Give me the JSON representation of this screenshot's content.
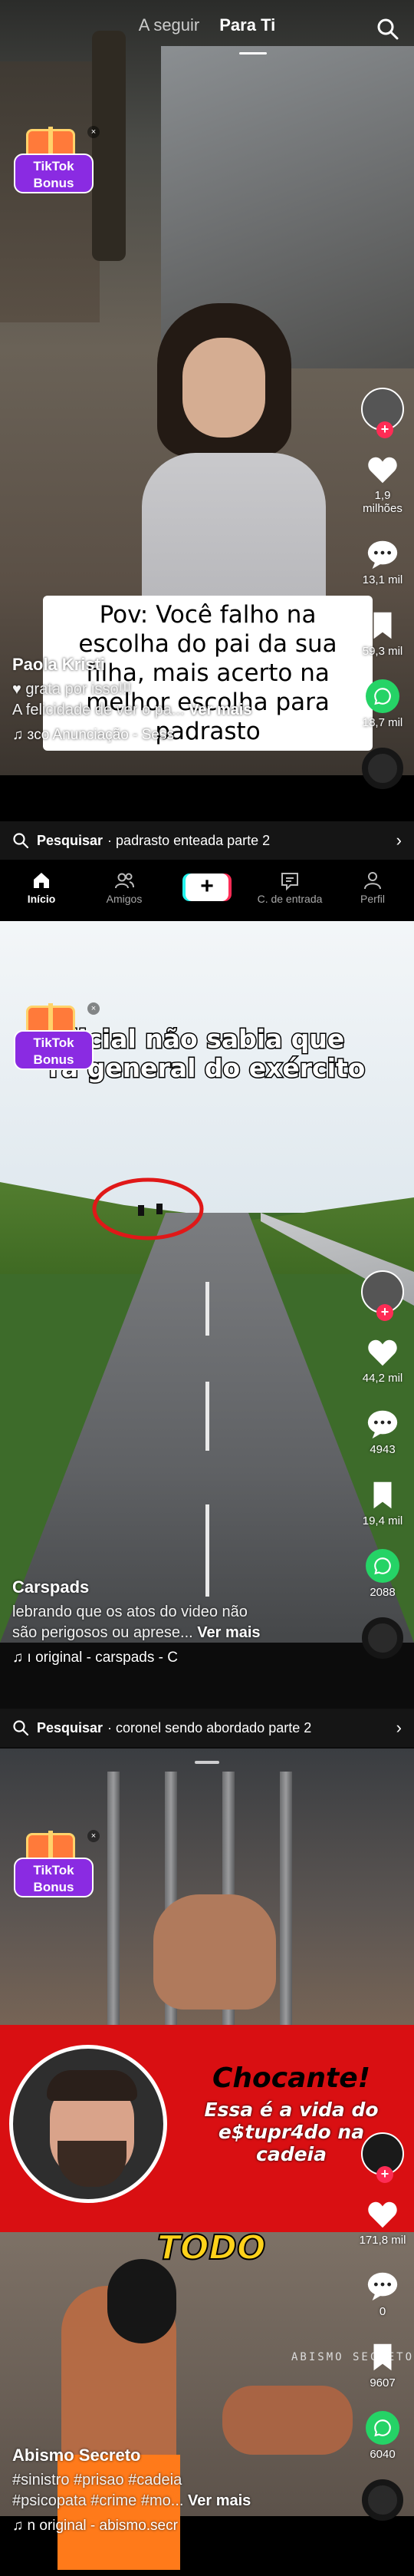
{
  "topnav": {
    "tab_following": "A seguir",
    "tab_for_you": "Para Ti"
  },
  "bonus": {
    "line1": "TikTok",
    "line2": "Bonus",
    "close": "×"
  },
  "colors": {
    "accent_red": "#fe2c55",
    "accent_cyan": "#25f4ee",
    "whatsapp": "#25d366",
    "bonus_purple": "#8a2be2"
  },
  "video1": {
    "overlay": "Pov: Você falho na escolha do pai da sua filha, mais acerto na melhor  escolha para padrasto",
    "author": "Paola Kristi",
    "desc_line1": "♥ grata por isso!!!",
    "desc_line2": "A felicidade de ver o pa...",
    "more": "Ver mais",
    "music": "♫ ɜco     Anunciação - Sess",
    "likes": "1,9 milhões",
    "comments": "13,1 mil",
    "saves": "59,3 mil",
    "shares": "18,7 mil",
    "search_prefix": "Pesquisar",
    "search_query": "· padrasto enteada parte 2"
  },
  "bottomnav": {
    "home": "Início",
    "friends": "Amigos",
    "create": "+",
    "inbox": "C. de entrada",
    "profile": "Perfil"
  },
  "video2": {
    "title_line1": "licial não sabia que",
    "title_line2": "ra general do exército",
    "author": "Carspads",
    "desc_line1": "lebrando que os atos do video não",
    "desc_line2": "são perigosos ou aprese...",
    "more": "Ver mais",
    "music": "♫ ı original - carspads - C",
    "likes": "44,2 mil",
    "comments": "4943",
    "saves": "19,4 mil",
    "shares": "2088",
    "search_prefix": "Pesquisar",
    "search_query": "· coronel sendo abordado parte 2"
  },
  "video3": {
    "banner_title": "Chocante!",
    "banner_sub": "Essa é a vida do e$tupr4do na cadeia",
    "todo": "TODO",
    "watermark": "ABISMO SECRETO",
    "author": "Abismo Secreto",
    "desc_line1": "#sinistro #prisao #cadeia",
    "desc_line2": "#psicopata #crime #mo...",
    "more": "Ver mais",
    "music": "♫ n original - abismo.secr",
    "likes": "171,8 mil",
    "comments": "0",
    "saves": "9607",
    "shares": "6040"
  }
}
